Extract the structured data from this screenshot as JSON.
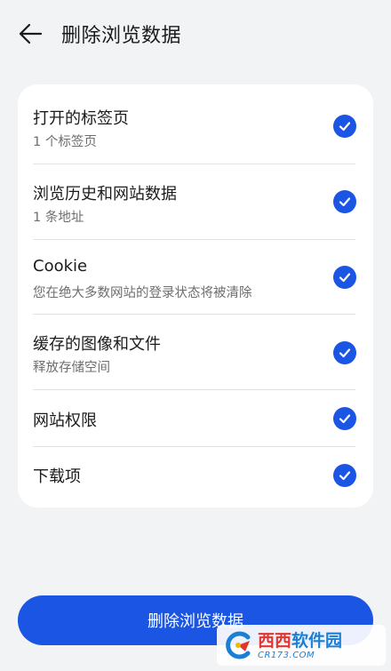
{
  "header": {
    "title": "删除浏览数据",
    "back_icon": "arrow-left-icon"
  },
  "options": [
    {
      "title": "打开的标签页",
      "subtitle": "1 个标签页",
      "checked": true
    },
    {
      "title": "浏览历史和网站数据",
      "subtitle": "1 条地址",
      "checked": true
    },
    {
      "title": "Cookie",
      "subtitle": "您在绝大多数网站的登录状态将被清除",
      "checked": true
    },
    {
      "title": "缓存的图像和文件",
      "subtitle": "释放存储空间",
      "checked": true
    },
    {
      "title": "网站权限",
      "subtitle": "",
      "checked": true
    },
    {
      "title": "下载项",
      "subtitle": "",
      "checked": true
    }
  ],
  "action": {
    "delete_label": "删除浏览数据"
  },
  "watermark": {
    "brand_red": "西西",
    "brand_blue": "软件园",
    "domain": "CR173.COM"
  },
  "colors": {
    "accent": "#1a55e3",
    "background": "#f1f3f5",
    "card": "#ffffff"
  }
}
